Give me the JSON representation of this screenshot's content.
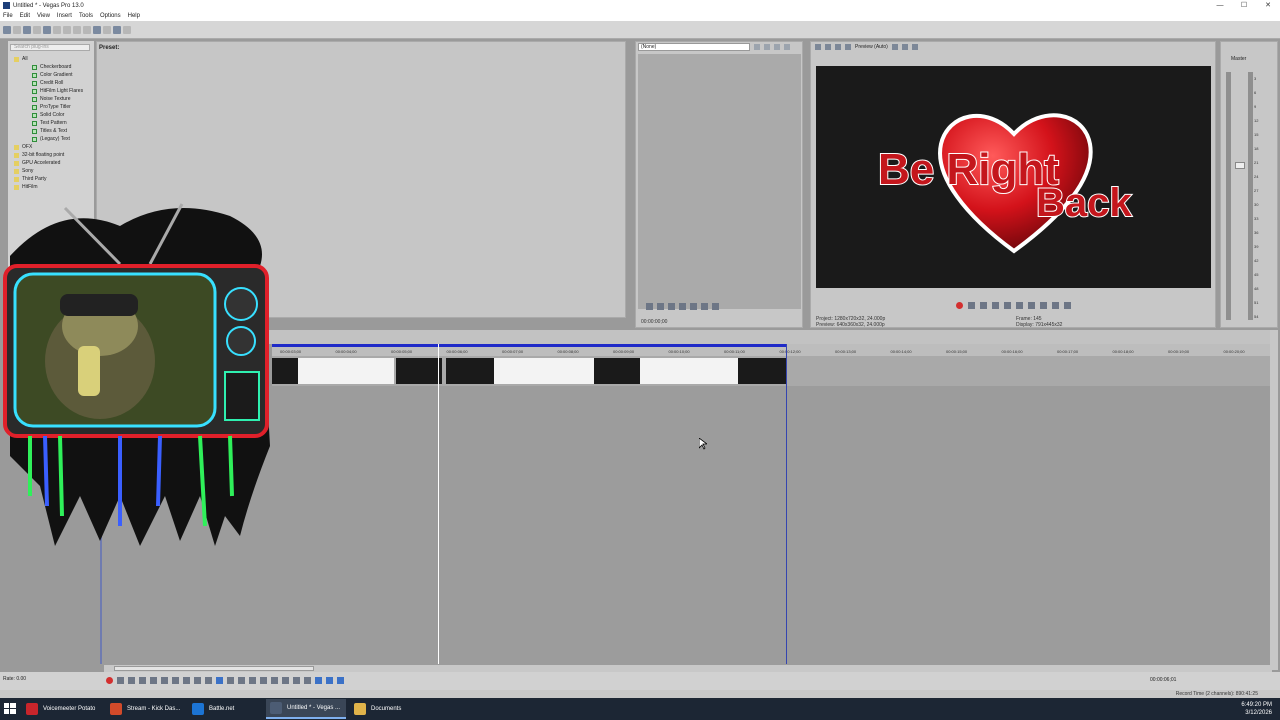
{
  "window": {
    "title": "Untitled * - Vegas Pro 13.0",
    "controls": [
      "—",
      "☐",
      "✕"
    ]
  },
  "menu": [
    "File",
    "Edit",
    "View",
    "Insert",
    "Tools",
    "Options",
    "Help"
  ],
  "plugins": {
    "search_placeholder": "Search plug-ins",
    "tree": [
      {
        "label": "All",
        "level": "top"
      },
      {
        "label": "Checkerboard",
        "level": "child"
      },
      {
        "label": "Color Gradient",
        "level": "child"
      },
      {
        "label": "Credit Roll",
        "level": "child"
      },
      {
        "label": "HitFilm Light Flares",
        "level": "child"
      },
      {
        "label": "Noise Texture",
        "level": "child"
      },
      {
        "label": "ProType Titler",
        "level": "child"
      },
      {
        "label": "Solid Color",
        "level": "child"
      },
      {
        "label": "Test Pattern",
        "level": "child"
      },
      {
        "label": "Titles & Text",
        "level": "child"
      },
      {
        "label": "(Legacy) Text",
        "level": "child"
      },
      {
        "label": "OFX",
        "level": "top"
      },
      {
        "label": "32-bit floating point",
        "level": "top"
      },
      {
        "label": "GPU Accelerated",
        "level": "top"
      },
      {
        "label": "Sony",
        "level": "top"
      },
      {
        "label": "Third Party",
        "level": "top"
      },
      {
        "label": "HitFilm",
        "level": "top"
      }
    ]
  },
  "preset": {
    "label": "Preset:"
  },
  "trimmer": {
    "selection": "(None)",
    "time": "00:00:00;00"
  },
  "preview": {
    "mode": "Preview (Auto)",
    "screen_text": {
      "line1": "Be Right",
      "line2": "Back"
    },
    "project_label": "Project:",
    "project_value": "1280x720x32, 24.000p",
    "preview_label": "Preview:",
    "preview_value": "640x360x32, 24.000p",
    "frame_label": "Frame:",
    "frame_value": "145",
    "display_label": "Display:",
    "display_value": "791x445x32"
  },
  "master": {
    "label": "Master",
    "scale": [
      "3",
      "6",
      "9",
      "12",
      "15",
      "18",
      "21",
      "24",
      "27",
      "30",
      "33",
      "36",
      "39",
      "42",
      "45",
      "48",
      "51",
      "54"
    ]
  },
  "timeline": {
    "ticks": [
      "00:00:03;00",
      "00:00:04;00",
      "00:00:05;00",
      "00:00:06;00",
      "00:00:07;00",
      "00:00:08;00",
      "00:00:09;00",
      "00:00:10;00",
      "00:00:11;00",
      "00:00:12;00",
      "00:00:13;00",
      "00:00:14;00",
      "00:00:15;00",
      "00:00:16;00",
      "00:00:17;00",
      "00:00:18;00",
      "00:00:19;00",
      "00:00:20;00"
    ],
    "cursor_tag": "6:00"
  },
  "transport": {
    "rate": "Rate: 0.00",
    "timecode": "00:00:06;01"
  },
  "status": {
    "record_time": "Record Time (2 channels): 890:41:25"
  },
  "taskbar": {
    "items": [
      {
        "label": "Voicemeeter Potato",
        "color": "#c9252b",
        "active": false
      },
      {
        "label": "Stream - Kick Das...",
        "color": "#d24a2a",
        "active": false
      },
      {
        "label": "Battle.net",
        "color": "#1c74d4",
        "active": false
      },
      {
        "label": "Untitled * - Vegas ...",
        "color": "#4c5c74",
        "active": true
      },
      {
        "label": "Documents",
        "color": "#e0b34a",
        "active": false
      }
    ],
    "time": "6:49:20 PM",
    "date": "3/12/2026"
  },
  "colors": {
    "heart_red": "#c4161c",
    "loop_blue": "#1f2ac8"
  }
}
